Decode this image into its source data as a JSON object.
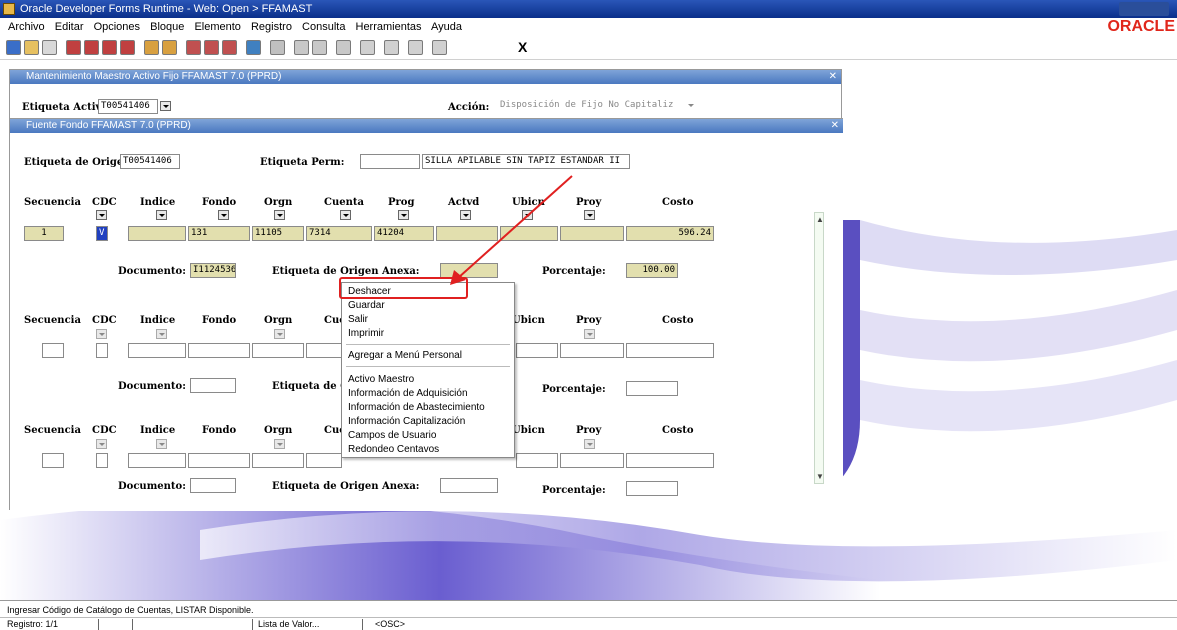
{
  "app": {
    "title": "Oracle Developer Forms Runtime - Web:  Open > FFAMAST",
    "brand": "ORACLE"
  },
  "menu": [
    "Archivo",
    "Editar",
    "Opciones",
    "Bloque",
    "Elemento",
    "Registro",
    "Consulta",
    "Herramientas",
    "Ayuda"
  ],
  "toolbar": {
    "exit_label": "X"
  },
  "outer_window": {
    "title": "Mantenimiento Maestro Activo Fijo  FFAMAST  7.0  (PPRD)",
    "etiqueta_label": "Etiqueta Activ",
    "etiqueta_value": "T00541406",
    "accion_label": "Acción:",
    "accion_value": "Disposición de Fijo No Capitaliz"
  },
  "inner_window": {
    "title": "Fuente Fondo  FFAMAST  7.0  (PPRD)",
    "origen_label": "Etiqueta de Origen",
    "origen_value": "T00541406",
    "perm_label": "Etiqueta Perm:",
    "perm_value": "",
    "desc_value": "SILLA APILABLE SIN TAPIZ ESTANDAR II"
  },
  "columns": [
    "Secuencia",
    "CDC",
    "Indice",
    "Fondo",
    "Orgn",
    "Cuenta",
    "Prog",
    "Actvd",
    "Ubicn",
    "Proy",
    "Costo"
  ],
  "record1": {
    "secuencia": "1",
    "cdc": "V",
    "indice": "",
    "fondo": "131",
    "orgn": "11105",
    "cuenta": "7314",
    "prog": "41204",
    "actvd": "",
    "ubicn": "",
    "proy": "",
    "costo": "596.24",
    "documento": "I1124536",
    "etiqueta_anexa": "",
    "porcentaje": "100.00"
  },
  "labels": {
    "documento": "Documento:",
    "etiqueta_anexa": "Etiqueta de Origen Anexa:",
    "etiqueta_anexa_cut": "Etiqueta de C",
    "porcentaje": "Porcentaje:",
    "cue": "Cue"
  },
  "context_menu": {
    "items": [
      "Deshacer",
      "Guardar",
      "Salir",
      "Imprimir",
      "Agregar a Menú Personal",
      "Activo Maestro",
      "Información de Adquisición",
      "Información de Abastecimiento",
      "Información Capitalización",
      "Campos de Usuario",
      "Redondeo Centavos"
    ]
  },
  "status": {
    "message": "Ingresar Código de Catálogo de Cuentas, LISTAR Disponible.",
    "record": "Registro: 1/1",
    "lov": "Lista de Valor...",
    "osc": "<OSC>"
  },
  "colors": {
    "accent": "#e02020",
    "field_yellow": "#e2dfae",
    "title_blue": "#4a78c0",
    "swoosh": "#5a4fc0"
  }
}
